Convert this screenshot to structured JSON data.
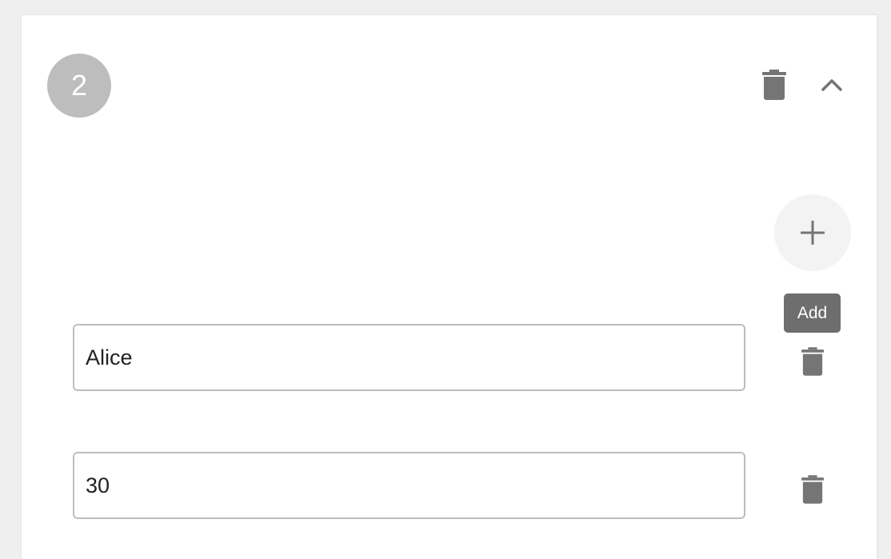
{
  "step": {
    "number": "2"
  },
  "header": {
    "delete_icon": "trash-icon",
    "collapse_icon": "chevron-up-icon"
  },
  "add": {
    "icon": "plus-icon",
    "tooltip": "Add"
  },
  "fields": [
    {
      "value": "Alice",
      "delete_icon": "trash-icon"
    },
    {
      "value": "30",
      "delete_icon": "trash-icon"
    }
  ],
  "colors": {
    "background": "#efefef",
    "card": "#ffffff",
    "badge": "#bdbdbd",
    "icon": "#757575",
    "tooltip": "#6e6e6e",
    "field_border": "#bdbdbd",
    "add_button_bg": "#f3f3f3"
  }
}
